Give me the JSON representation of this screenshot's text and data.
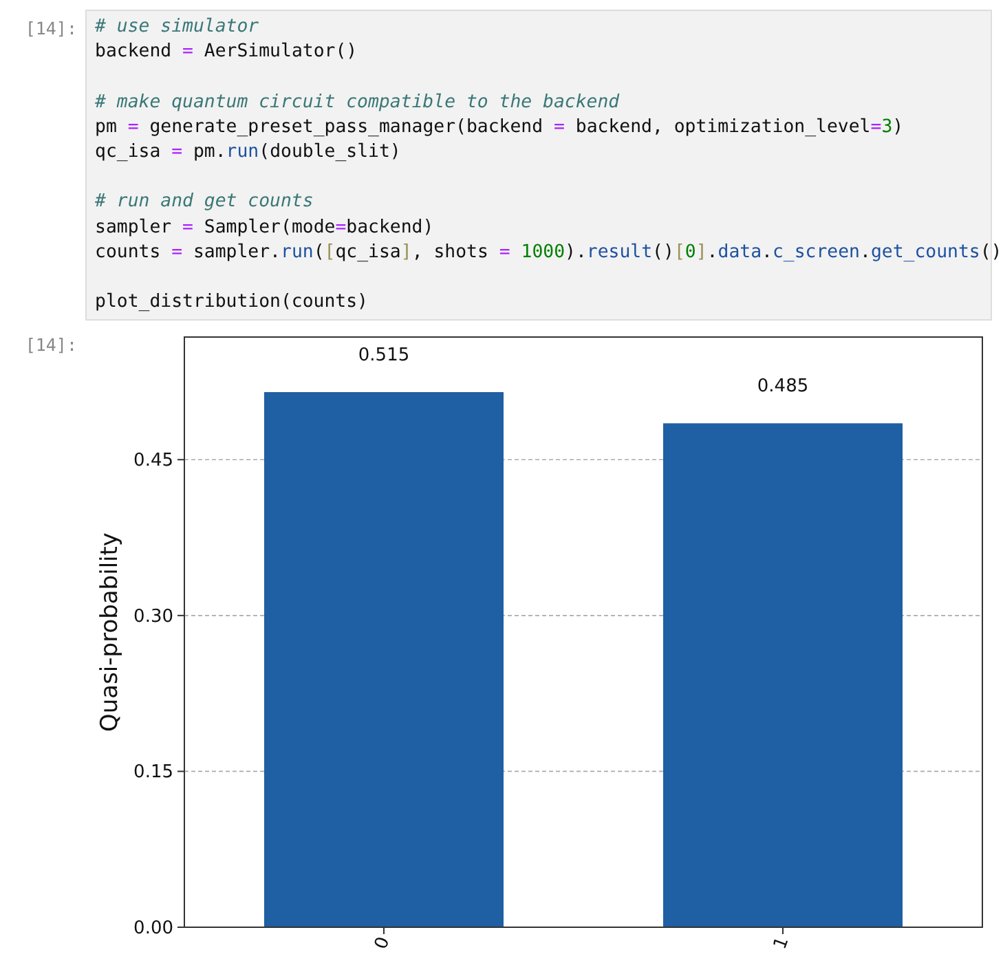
{
  "input_cell": {
    "prompt": "[14]:",
    "blocks": [
      [
        [
          {
            "kind": "comment",
            "text": "# use simulator"
          }
        ],
        [
          {
            "kind": "plain",
            "text": "backend "
          },
          {
            "kind": "operator",
            "text": "="
          },
          {
            "kind": "plain",
            "text": " AerSimulator()"
          }
        ]
      ],
      [
        [
          {
            "kind": "comment",
            "text": "# make quantum circuit compatible to the backend"
          }
        ],
        [
          {
            "kind": "plain",
            "text": "pm "
          },
          {
            "kind": "operator",
            "text": "="
          },
          {
            "kind": "plain",
            "text": " generate_preset_pass_manager(backend "
          },
          {
            "kind": "operator",
            "text": "="
          },
          {
            "kind": "plain",
            "text": " backend, optimization_level"
          },
          {
            "kind": "operator",
            "text": "="
          },
          {
            "kind": "number",
            "text": "3"
          },
          {
            "kind": "plain",
            "text": ")"
          }
        ],
        [
          {
            "kind": "plain",
            "text": "qc_isa "
          },
          {
            "kind": "operator",
            "text": "="
          },
          {
            "kind": "plain",
            "text": " pm."
          },
          {
            "kind": "attribute",
            "text": "run"
          },
          {
            "kind": "plain",
            "text": "(double_slit)"
          }
        ]
      ],
      [
        [
          {
            "kind": "comment",
            "text": "# run and get counts"
          }
        ],
        [
          {
            "kind": "plain",
            "text": "sampler "
          },
          {
            "kind": "operator",
            "text": "="
          },
          {
            "kind": "plain",
            "text": " Sampler(mode"
          },
          {
            "kind": "operator",
            "text": "="
          },
          {
            "kind": "plain",
            "text": "backend)"
          }
        ],
        [
          {
            "kind": "plain",
            "text": "counts "
          },
          {
            "kind": "operator",
            "text": "="
          },
          {
            "kind": "plain",
            "text": " sampler."
          },
          {
            "kind": "attribute",
            "text": "run"
          },
          {
            "kind": "plain",
            "text": "("
          },
          {
            "kind": "bracket",
            "text": "["
          },
          {
            "kind": "plain",
            "text": "qc_isa"
          },
          {
            "kind": "bracket",
            "text": "]"
          },
          {
            "kind": "plain",
            "text": ", shots "
          },
          {
            "kind": "operator",
            "text": "= "
          },
          {
            "kind": "number",
            "text": "1000"
          },
          {
            "kind": "plain",
            "text": ")."
          },
          {
            "kind": "attribute",
            "text": "result"
          },
          {
            "kind": "plain",
            "text": "()"
          },
          {
            "kind": "bracket",
            "text": "["
          },
          {
            "kind": "number",
            "text": "0"
          },
          {
            "kind": "bracket",
            "text": "]"
          },
          {
            "kind": "plain",
            "text": "."
          },
          {
            "kind": "attribute",
            "text": "data"
          },
          {
            "kind": "plain",
            "text": "."
          },
          {
            "kind": "attribute",
            "text": "c_screen"
          },
          {
            "kind": "plain",
            "text": "."
          },
          {
            "kind": "attribute",
            "text": "get_counts"
          },
          {
            "kind": "plain",
            "text": "()"
          }
        ]
      ],
      [
        [
          {
            "kind": "plain",
            "text": "plot_distribution(counts)"
          }
        ]
      ]
    ]
  },
  "output_cell": {
    "prompt": "[14]:",
    "chart_data": {
      "type": "bar",
      "ylabel": "Quasi-probability",
      "categories": [
        "0",
        "1"
      ],
      "series": [
        {
          "color": "#1f5fa3",
          "values": [
            0.515,
            0.485
          ]
        }
      ],
      "ylim": [
        0,
        0.568
      ],
      "grid": true,
      "yticks": [
        {
          "value": 0,
          "label": "0.00"
        },
        {
          "value": 0.15,
          "label": "0.15"
        },
        {
          "value": 0.3,
          "label": "0.30"
        },
        {
          "value": 0.45,
          "label": "0.45"
        }
      ],
      "value_labels": [
        "0.515",
        "0.485"
      ]
    }
  }
}
